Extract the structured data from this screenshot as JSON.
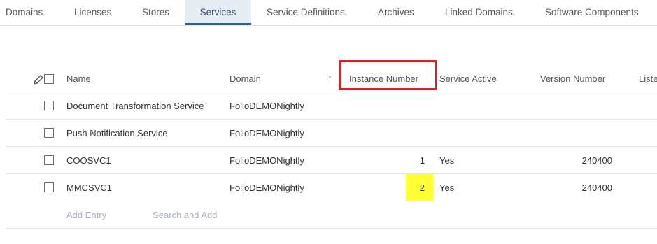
{
  "tabs": [
    {
      "label": "Domains"
    },
    {
      "label": "Licenses"
    },
    {
      "label": "Stores"
    },
    {
      "label": "Services",
      "active": true
    },
    {
      "label": "Service Definitions"
    },
    {
      "label": "Archives"
    },
    {
      "label": "Linked Domains"
    },
    {
      "label": "Software Components"
    }
  ],
  "table": {
    "columns": {
      "name": "Name",
      "domain": "Domain",
      "instance_number": "Instance Number",
      "service_active": "Service Active",
      "version_number": "Version Number",
      "listen_partial": "Liste"
    },
    "rows": [
      {
        "name": "Document Transformation Service",
        "domain": "FolioDEMONightly",
        "instance": "",
        "active": "",
        "version": ""
      },
      {
        "name": "Push Notification Service",
        "domain": "FolioDEMONightly",
        "instance": "",
        "active": "",
        "version": ""
      },
      {
        "name": "COOSVC1",
        "domain": "FolioDEMONightly",
        "instance": "1",
        "active": "Yes",
        "version": "240400"
      },
      {
        "name": "MMCSVC1",
        "domain": "FolioDEMONightly",
        "instance": "2",
        "active": "Yes",
        "version": "240400"
      }
    ],
    "add_entry": "Add Entry",
    "search_and_add": "Search and Add"
  },
  "icons": {
    "edit": "pencil-icon",
    "sort": "sort-ascending-icon"
  },
  "colors": {
    "active_tab_bg": "#e6ecf2",
    "active_tab_underline": "#2f5d8a",
    "annotation_red": "#e11b22",
    "highlight_yellow": "#ffff33",
    "muted_link": "#a9b3c2"
  }
}
